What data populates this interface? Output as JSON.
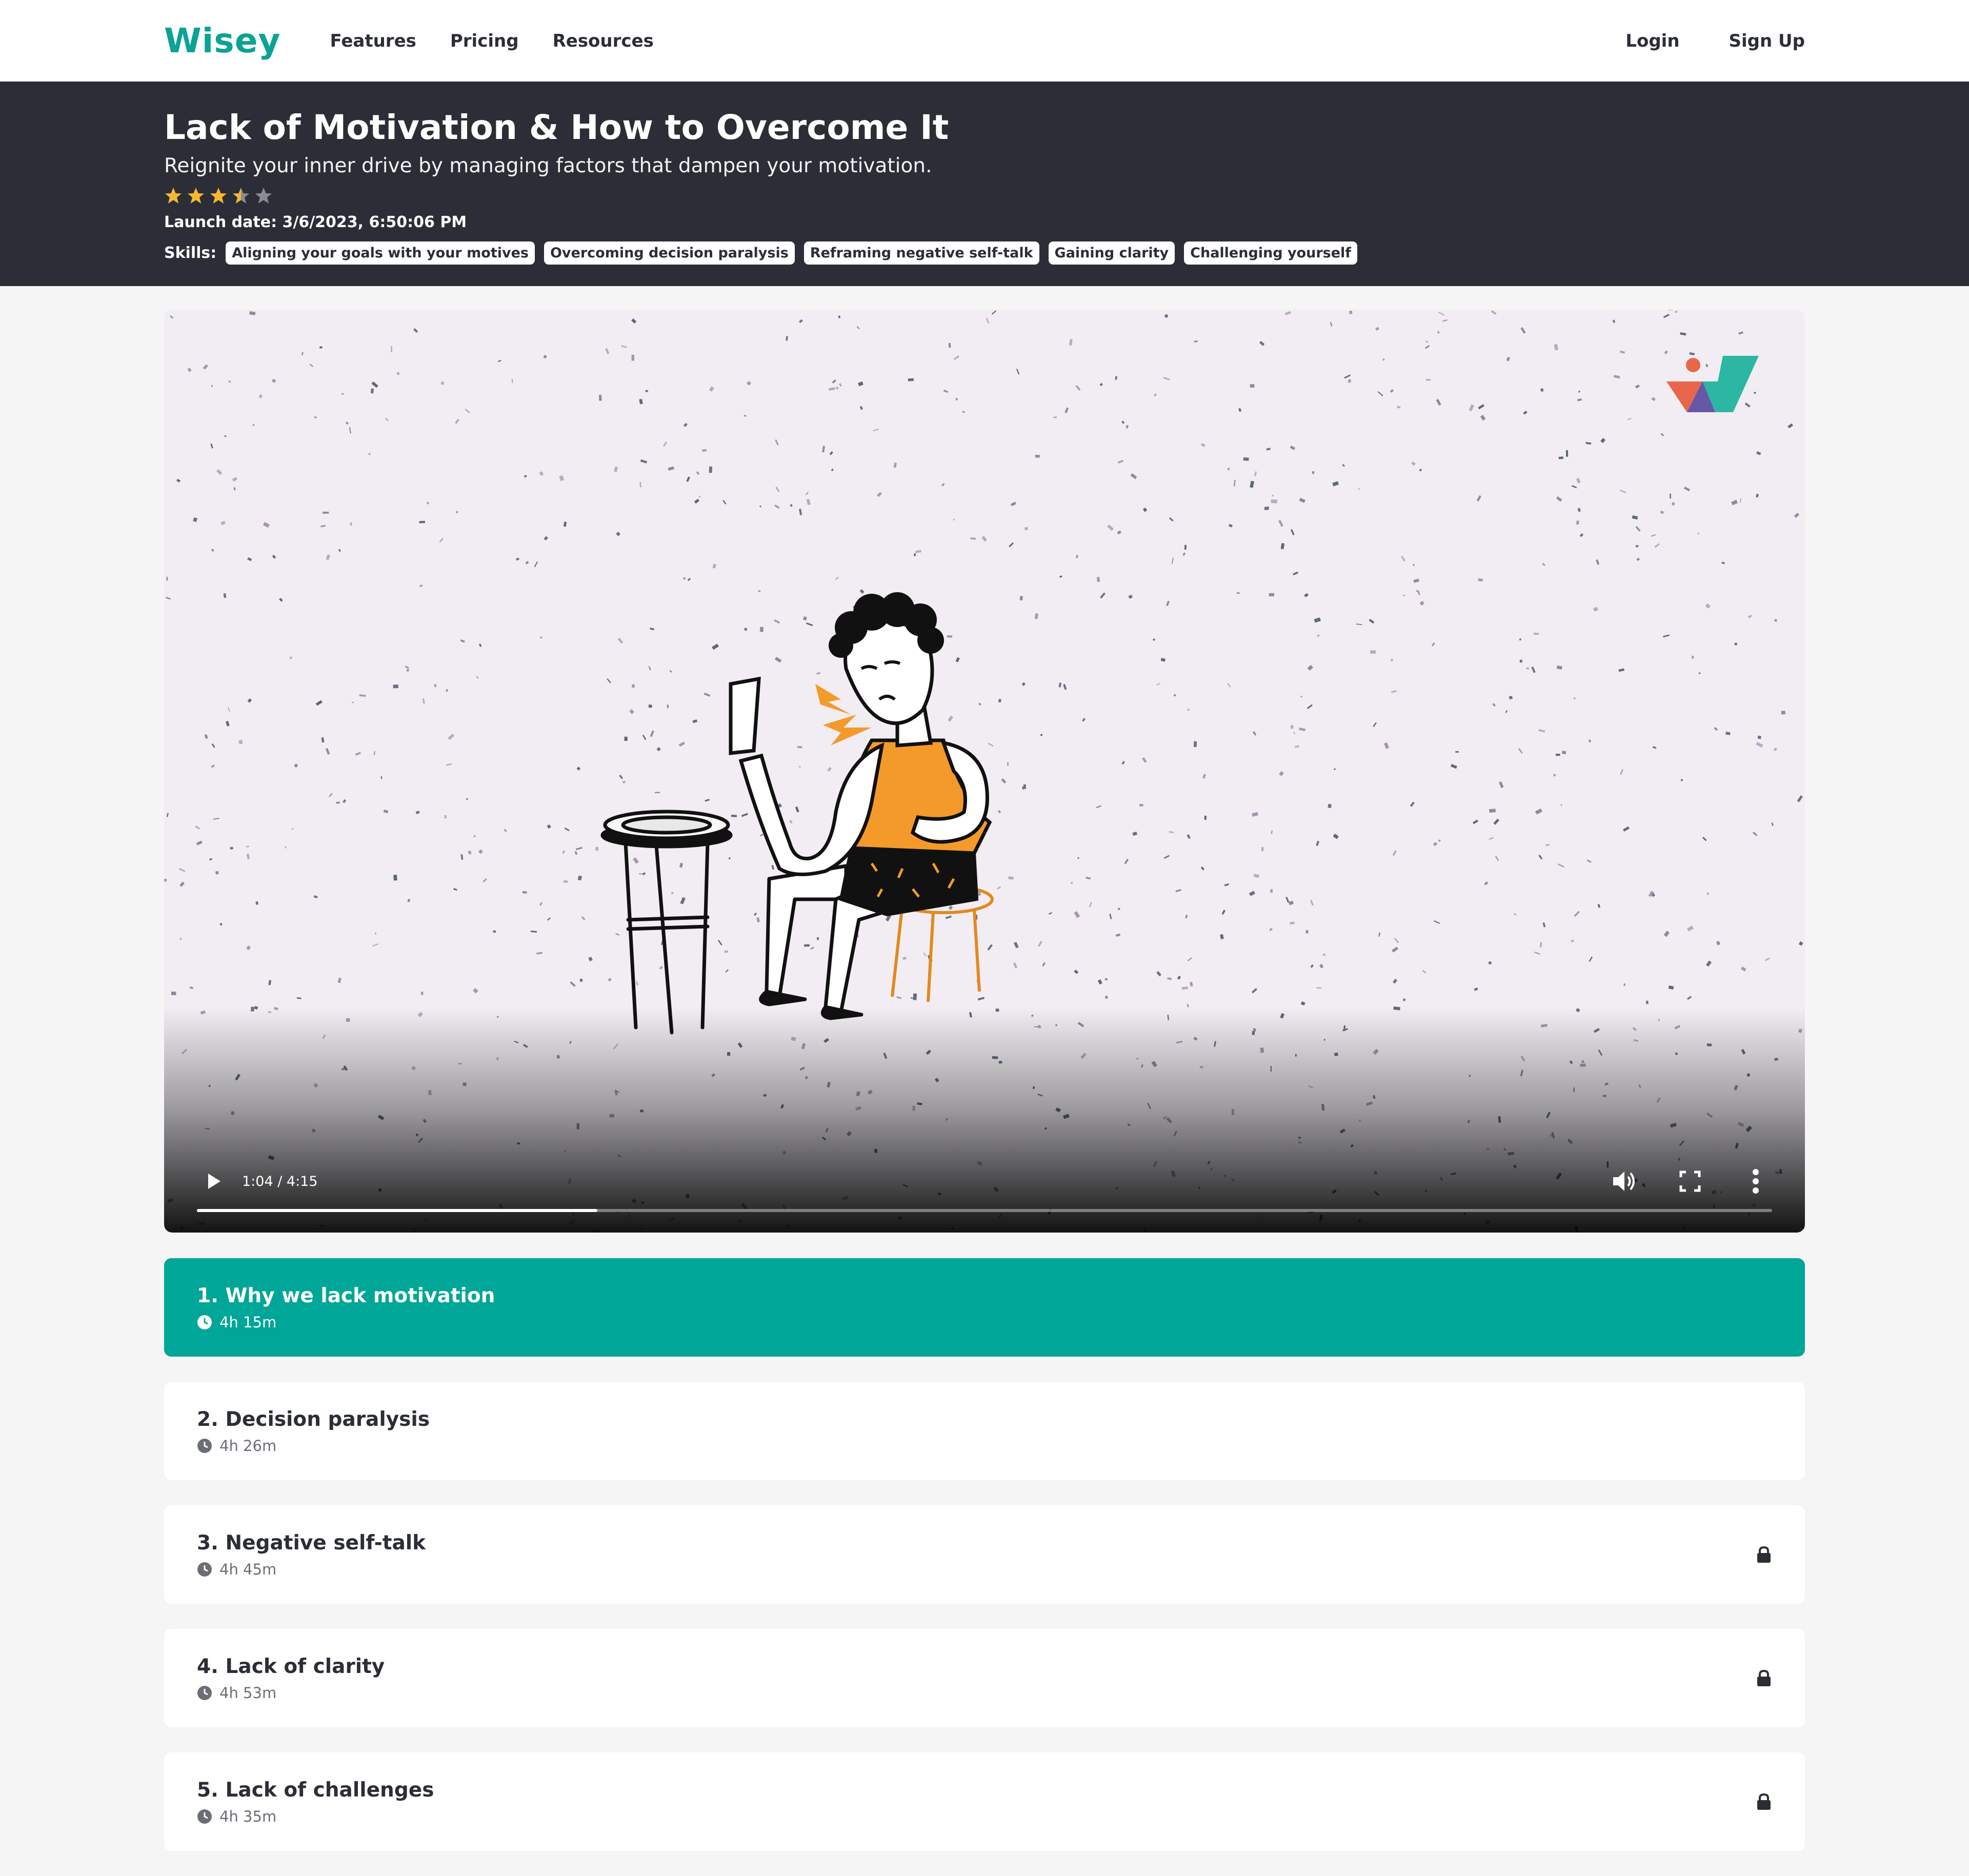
{
  "brand": {
    "logo": "Wisey",
    "accent_color": "#0aa396"
  },
  "nav": {
    "links": [
      "Features",
      "Pricing",
      "Resources"
    ],
    "login": "Login",
    "signup": "Sign Up"
  },
  "course": {
    "title": "Lack of Motivation & How to Overcome It",
    "subtitle": "Reignite your inner drive by managing factors that dampen your motivation.",
    "rating": 3.5,
    "rating_max": 5,
    "launch": "Launch date: 3/6/2023, 6:50:06 PM",
    "skills_label": "Skills:",
    "skills": [
      "Aligning your goals with your motives",
      "Overcoming decision paralysis",
      "Reframing negative self-talk",
      "Gaining clarity",
      "Challenging yourself"
    ]
  },
  "video": {
    "time": "1:04 / 4:15",
    "progress": 0.2541,
    "icons": [
      "play-icon",
      "volume-icon",
      "fullscreen-icon",
      "more-options-icon"
    ]
  },
  "lessons": [
    {
      "title": "1. Why we lack motivation",
      "duration": "4h 15m",
      "active": true,
      "locked": false
    },
    {
      "title": "2. Decision paralysis",
      "duration": "4h 26m",
      "active": false,
      "locked": false
    },
    {
      "title": "3. Negative self-talk",
      "duration": "4h 45m",
      "active": false,
      "locked": true
    },
    {
      "title": "4. Lack of clarity",
      "duration": "4h 53m",
      "active": false,
      "locked": true
    },
    {
      "title": "5. Lack of challenges",
      "duration": "4h 35m",
      "active": false,
      "locked": true
    }
  ]
}
